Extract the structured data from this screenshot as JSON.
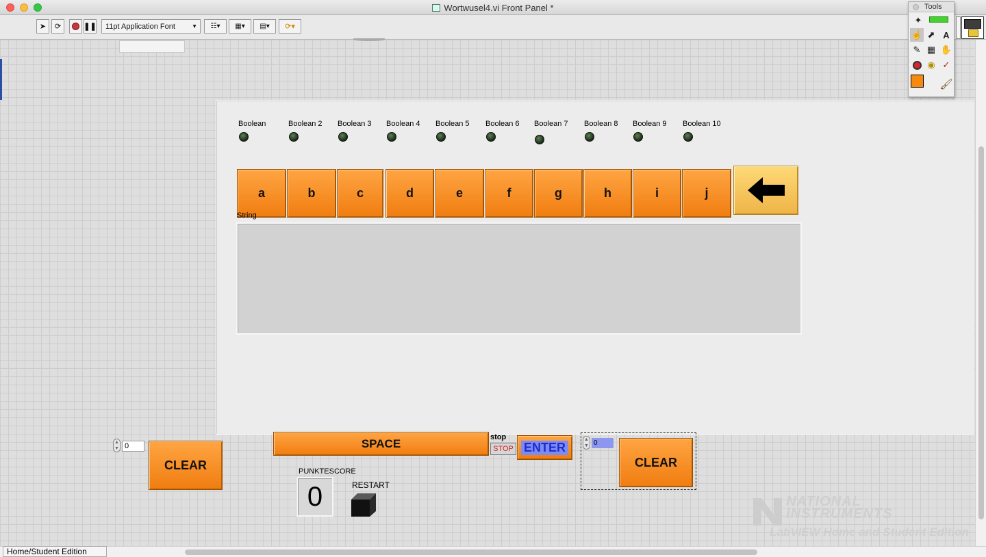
{
  "window": {
    "title": "Wortwusel4.vi Front Panel *"
  },
  "toolbar": {
    "font_selector": "11pt Application Font"
  },
  "tools_palette": {
    "title": "Tools"
  },
  "booleans": [
    "Boolean",
    "Boolean 2",
    "Boolean 3",
    "Boolean 4",
    "Boolean 5",
    "Boolean 6",
    "Boolean 7",
    "Boolean 8",
    "Boolean 9",
    "Boolean 10"
  ],
  "letter_keys": [
    "a",
    "b",
    "c",
    "d",
    "e",
    "f",
    "g",
    "h",
    "i",
    "j"
  ],
  "string_indicator": {
    "label": "String",
    "value": ""
  },
  "controls": {
    "space_label": "SPACE",
    "stop_caption": "stop",
    "stop_label": "STOP",
    "enter_label": "ENTER",
    "clear_left_label": "CLEAR",
    "clear_right_label": "CLEAR",
    "numeric_left_value": "0",
    "numeric_right_value": "0",
    "score_caption": "PUNKTESCORE",
    "score_value": "0",
    "restart_caption": "RESTART"
  },
  "status_bar": {
    "edition": "Home/Student Edition"
  },
  "watermark": {
    "brand_line1": "NATIONAL",
    "brand_line2": "INSTRUMENTS",
    "edition": "LabVIEW Home and Student Edition"
  },
  "colors": {
    "key_orange": "#f58a1f",
    "backspace_yellow": "#f5c85a",
    "enter_text": "#1d2bd0"
  }
}
